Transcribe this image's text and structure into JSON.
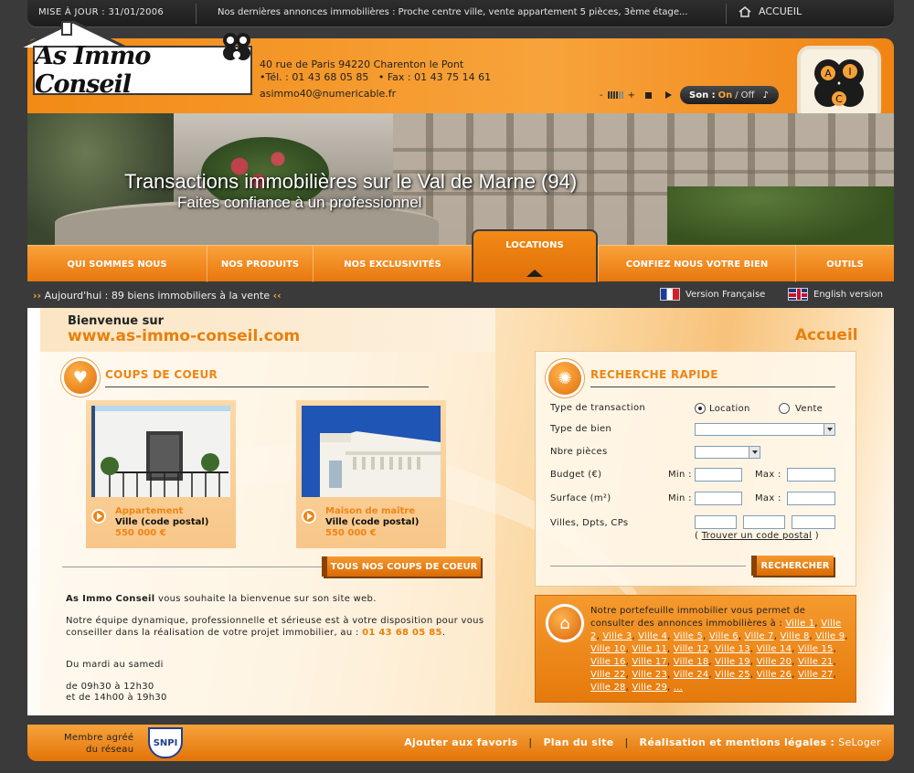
{
  "topbar": {
    "maj": "MISE À JOUR : 31/01/2006",
    "news": "Nos dernières annonces immobilières : Proche centre ville, vente appartement 5 pièces, 3ème étage...",
    "home_label": "ACCUEIL"
  },
  "header": {
    "logo_text": "As Immo Conseil",
    "address": "40 rue de Paris 94220 Charenton le Pont",
    "tel": "Tél. : 01 43 68 05 85",
    "fax": "Fax : 01 43 75 14 61",
    "email": "asimmo40@numericable.fr",
    "sound_label": "Son :",
    "sound_on": "On",
    "sound_sep": "/",
    "sound_off": "Off",
    "badge_letters": [
      "A",
      "I",
      "C"
    ]
  },
  "hero": {
    "title": "Transactions immobilières sur le Val de Marne (94)",
    "subtitle": "Faites confiance à un professionnel"
  },
  "nav": {
    "items": [
      "QUI SOMMES NOUS",
      "NOS PRODUITS",
      "NOS EXCLUSIVITÉS",
      "LOCATIONS",
      "CONFIEZ NOUS VOTRE BIEN",
      "OUTILS"
    ],
    "active": "LOCATIONS"
  },
  "infobar": {
    "today": "Aujourd'hui : 89 biens immobiliers à la vente",
    "fr": "Version Française",
    "en": "English version"
  },
  "main": {
    "welcome_line1": "Bienvenue sur",
    "welcome_line2": "www.as-immo-conseil.com",
    "accueil": "Accueil",
    "coups_title": "COUPS DE COEUR",
    "cards": [
      {
        "type": "Appartement",
        "ville": "Ville (code postal)",
        "price": "550 000 €"
      },
      {
        "type": "Maison de maître",
        "ville": "Ville (code postal)",
        "price": "550 000 €"
      }
    ],
    "all_button": "TOUS NOS COUPS DE COEUR",
    "text_company": "As Immo Conseil",
    "text_p1_rest": " vous souhaite la bienvenue sur son site web.",
    "text_p2": "Notre équipe dynamique, professionnelle et sérieuse est à votre disposition pour vous conseiller dans la réalisation de votre projet immobilier, au :",
    "text_phone": "01 43 68 05 85",
    "text_p2_end": ".",
    "hours_days": "Du mardi au samedi",
    "hours_1": "de 09h30 à 12h30",
    "hours_2": "et de 14h00 à 19h30"
  },
  "search": {
    "title": "RECHERCHE RAPIDE",
    "transaction_label": "Type de transaction",
    "opt_location": "Location",
    "opt_vente": "Vente",
    "selected": "Location",
    "bien_label": "Type de bien",
    "pieces_label": "Nbre pièces",
    "budget_label": "Budget (€)",
    "surface_label": "Surface (m²)",
    "min": "Min :",
    "max": "Max :",
    "villes_label": "Villes, Dpts, CPs",
    "find_cp_open": "( ",
    "find_cp": "Trouver un code postal",
    "find_cp_close": " )",
    "submit": "RECHERCHER"
  },
  "portfolio": {
    "intro": "Notre portefeuille immobilier vous permet de consulter des annonces immobilières à :",
    "cities": [
      "Ville 1",
      "Ville 2",
      "Ville 3",
      "Ville 4",
      "Ville 5",
      "Ville 6",
      "Ville 7",
      "Ville 8",
      "Ville 9",
      "Ville 10",
      "Ville 11",
      "Ville 12",
      "Ville 13",
      "Ville 14",
      "Ville 15",
      "Ville 16",
      "Ville 17",
      "Ville 18",
      "Ville 19",
      "Ville 20",
      "Ville 21",
      "Ville 22",
      "Ville 23",
      "Ville 24",
      "Ville 25",
      "Ville 26",
      "Ville 27",
      "Ville 28",
      "Ville 29",
      "..."
    ]
  },
  "footer": {
    "member_1": "Membre agréé",
    "member_2": "du réseau",
    "snpi": "SNPI",
    "favoris": "Ajouter aux favoris",
    "plan": "Plan du site",
    "mentions": "Réalisation et mentions légales :",
    "seloger": "SeLoger",
    "pipe": "|"
  },
  "colors": {
    "accent": "#f08414",
    "dark": "#3a3a3a"
  }
}
